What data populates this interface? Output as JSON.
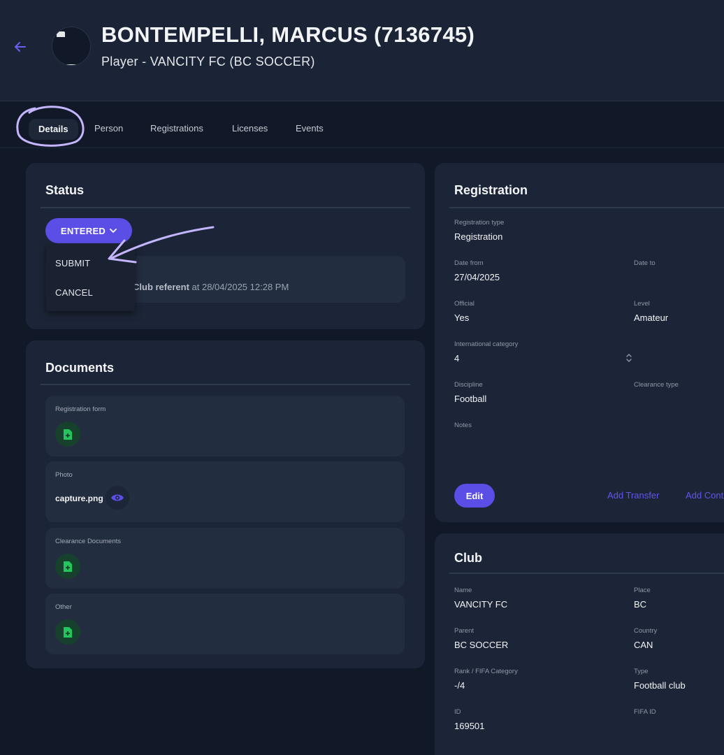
{
  "header": {
    "back_icon": "arrow-left-icon",
    "title": "BONTEMPELLI, MARCUS (7136745)",
    "subtitle": "Player - VANCITY FC (BC SOCCER)"
  },
  "tabs": [
    {
      "label": "Details",
      "active": true
    },
    {
      "label": "Person"
    },
    {
      "label": "Registrations"
    },
    {
      "label": "Licenses"
    },
    {
      "label": "Events"
    }
  ],
  "status": {
    "title": "Status",
    "current": "ENTERED",
    "menu": [
      "SUBMIT",
      "CANCEL"
    ],
    "entry_author": "Club referent",
    "entry_at": " at 28/04/2025 12:28 PM"
  },
  "documents": {
    "title": "Documents",
    "items": [
      {
        "label": "Registration form"
      },
      {
        "label": "Photo",
        "file": "capture.png"
      },
      {
        "label": "Clearance Documents"
      },
      {
        "label": "Other"
      }
    ]
  },
  "registration": {
    "title": "Registration",
    "type_label": "Registration type",
    "type_value": "Registration",
    "date_from_label": "Date from",
    "date_from_value": "27/04/2025",
    "date_to_label": "Date to",
    "official_label": "Official",
    "official_value": "Yes",
    "level_label": "Level",
    "level_value": "Amateur",
    "intl_label": "International category",
    "intl_value": "4",
    "discipline_label": "Discipline",
    "discipline_value": "Football",
    "clearance_label": "Clearance type",
    "notes_label": "Notes",
    "edit_label": "Edit",
    "add_transfer_label": "Add Transfer",
    "add_cont_label": "Add Cont"
  },
  "club": {
    "title": "Club",
    "name_label": "Name",
    "name_value": "VANCITY FC",
    "place_label": "Place",
    "place_value": "BC",
    "parent_label": "Parent",
    "parent_value": "BC SOCCER",
    "country_label": "Country",
    "country_value": "CAN",
    "rank_label": "Rank / FIFA Category",
    "rank_value": "-/4",
    "type_label": "Type",
    "type_value": "Football club",
    "id_label": "ID",
    "id_value": "169501",
    "fifa_id_label": "FIFA ID"
  },
  "colors": {
    "accent": "#5a4ee6",
    "annotation": "#c4b5fd",
    "page_bg": "#111827",
    "card_bg": "#1c2537",
    "doc_add": "#16412c"
  }
}
